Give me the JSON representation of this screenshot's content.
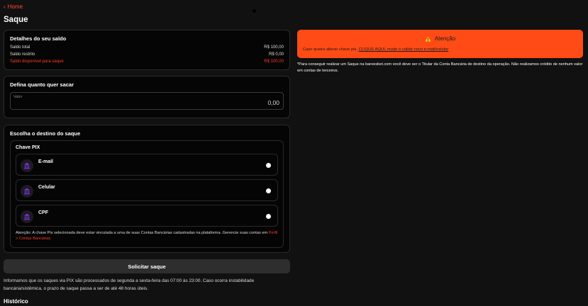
{
  "nav": {
    "home_label": "Home"
  },
  "page": {
    "title": "Saque"
  },
  "balance": {
    "title": "Detalhes do seu saldo",
    "rows": [
      {
        "label": "Saldo total",
        "value": "R$ 100,00"
      },
      {
        "label": "Saldo restrito",
        "value": "R$ 0,00"
      },
      {
        "label": "Saldo disponível para saque",
        "value": "R$ 100,00"
      }
    ]
  },
  "amount": {
    "title": "Defina quanto quer sacar",
    "label": "Valor",
    "value": "0,00"
  },
  "destination": {
    "title": "Escolha o destino do saque",
    "pix_title": "Chave PIX",
    "options": [
      {
        "label": "E-mail",
        "icon": "bank-icon"
      },
      {
        "label": "Celular",
        "icon": "bank-icon"
      },
      {
        "label": "CPF",
        "icon": "bank-icon"
      }
    ],
    "note": "Atenção: A chave Pix selecionada deve estar vinculada a uma de suas Contas Bancárias cadastradas na plataforma. Gerencie suas contas em",
    "note_link": "Perfil > Contas Bancárias."
  },
  "submit_label": "Solicitar saque",
  "info": "Informamos que os saques via PIX são processados de segunda a sexta-feira das 07:00 às 23:00. Caso ocorra instabilidade bancária/sistêmica, o prazo de saque passa a ser de até 48 horas úteis.",
  "history_title": "Histórico",
  "attention": {
    "title": "Atenção",
    "body_prefix": "Caso queira alterar chave pix,",
    "body_link": "CLIQUE AQUI, mude o valide novo e-mail/celular",
    "icon": "warning-icon"
  },
  "side_note": "*Para conseguir realizar um Saque na baroesbet.com você deve ser o Titular da Conta Bancária de destino da operação. Não realizamos crédito de nenhum valor em contas de terceiros.",
  "colors": {
    "accent": "#ff4b16",
    "danger_text": "#ff3b1f",
    "background": "#111111",
    "card": "#050505"
  }
}
